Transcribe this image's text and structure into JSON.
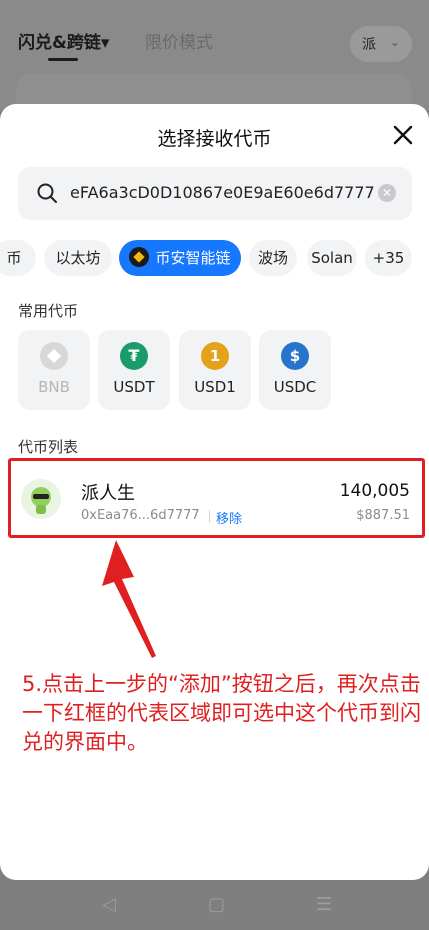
{
  "background": {
    "tabs": [
      {
        "label": "闪兑&跨链▾"
      },
      {
        "label": "限价模式"
      }
    ],
    "avatar_char": "派"
  },
  "sheet": {
    "title": "选择接收代币",
    "close_icon": "close-icon"
  },
  "search": {
    "value": "eFA6a3cD0D10867e0E9aE60e6d7777",
    "icon": "search-icon"
  },
  "chains": [
    {
      "label": "币"
    },
    {
      "label": "以太坊"
    },
    {
      "label": "币安智能链",
      "active": true
    },
    {
      "label": "波场"
    },
    {
      "label": "Solan"
    },
    {
      "label": "+35"
    }
  ],
  "common_tokens": {
    "label": "常用代币",
    "items": [
      {
        "name": "BNB",
        "disabled": true,
        "color": "#d7d7d7"
      },
      {
        "name": "USDT",
        "color": "#1a9b6c"
      },
      {
        "name": "USD1",
        "color": "#e3a21a"
      },
      {
        "name": "USDC",
        "color": "#2775ca"
      }
    ]
  },
  "token_list": {
    "label": "代币列表",
    "items": [
      {
        "name": "派人生",
        "address": "0xEaa76...6d7777",
        "remove_label": "移除",
        "amount": "140,005",
        "value": "$887.51"
      }
    ]
  },
  "instruction": "5.点击上一步的“添加”按钮之后，再次点击一下红框的代表区域即可选中这个代币到闪兑的界面中。",
  "colors": {
    "accent": "#1677ff",
    "highlight_red": "#e02020"
  }
}
